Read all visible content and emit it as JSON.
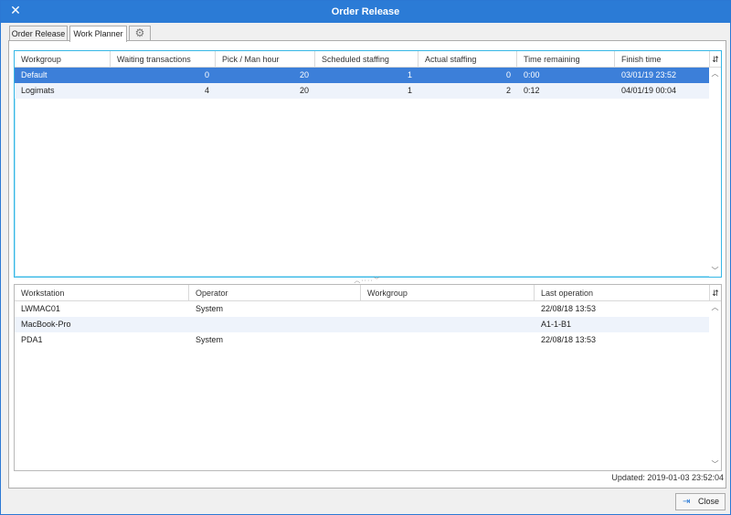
{
  "window": {
    "title": "Order Release"
  },
  "tabs": [
    {
      "label": "Order Release",
      "active": false
    },
    {
      "label": "Work Planner",
      "active": true
    },
    {
      "label": "",
      "icon": "gear-icon",
      "active": false
    }
  ],
  "workgroups": {
    "columns": [
      "Workgroup",
      "Waiting transactions",
      "Pick / Man hour",
      "Scheduled staffing",
      "Actual staffing",
      "Time remaining",
      "Finish time"
    ],
    "rows": [
      [
        "Default",
        "0",
        "20",
        "1",
        "0",
        "0:00",
        "03/01/19 23:52"
      ],
      [
        "Logimats",
        "4",
        "20",
        "1",
        "2",
        "0:12",
        "04/01/19 00:04"
      ]
    ],
    "selected_row": 0
  },
  "workstations": {
    "columns": [
      "Workstation",
      "Operator",
      "Workgroup",
      "Last operation"
    ],
    "rows": [
      [
        "LWMAC01",
        "System",
        "",
        "22/08/18 13:53"
      ],
      [
        "MacBook-Pro",
        "",
        "",
        "A1-1-B1"
      ],
      [
        "PDA1",
        "System",
        "",
        "22/08/18 13:53"
      ]
    ]
  },
  "status": {
    "updated": "Updated: 2019-01-03 23:52:04"
  },
  "footer": {
    "close_label": "Close"
  },
  "icons": {
    "close_window": "close-icon",
    "gear": "gear-icon",
    "column_chooser": "column-chooser-icon",
    "scroll_up": "chevron-up-icon",
    "scroll_down": "chevron-down-icon",
    "splitter": "splitter-grip-icon",
    "exit": "exit-icon"
  },
  "colors": {
    "titlebar": "#2b7bd6",
    "selection": "#3c7fd9",
    "focus_border": "#36b7e6",
    "alt_row": "#eef3fb"
  }
}
